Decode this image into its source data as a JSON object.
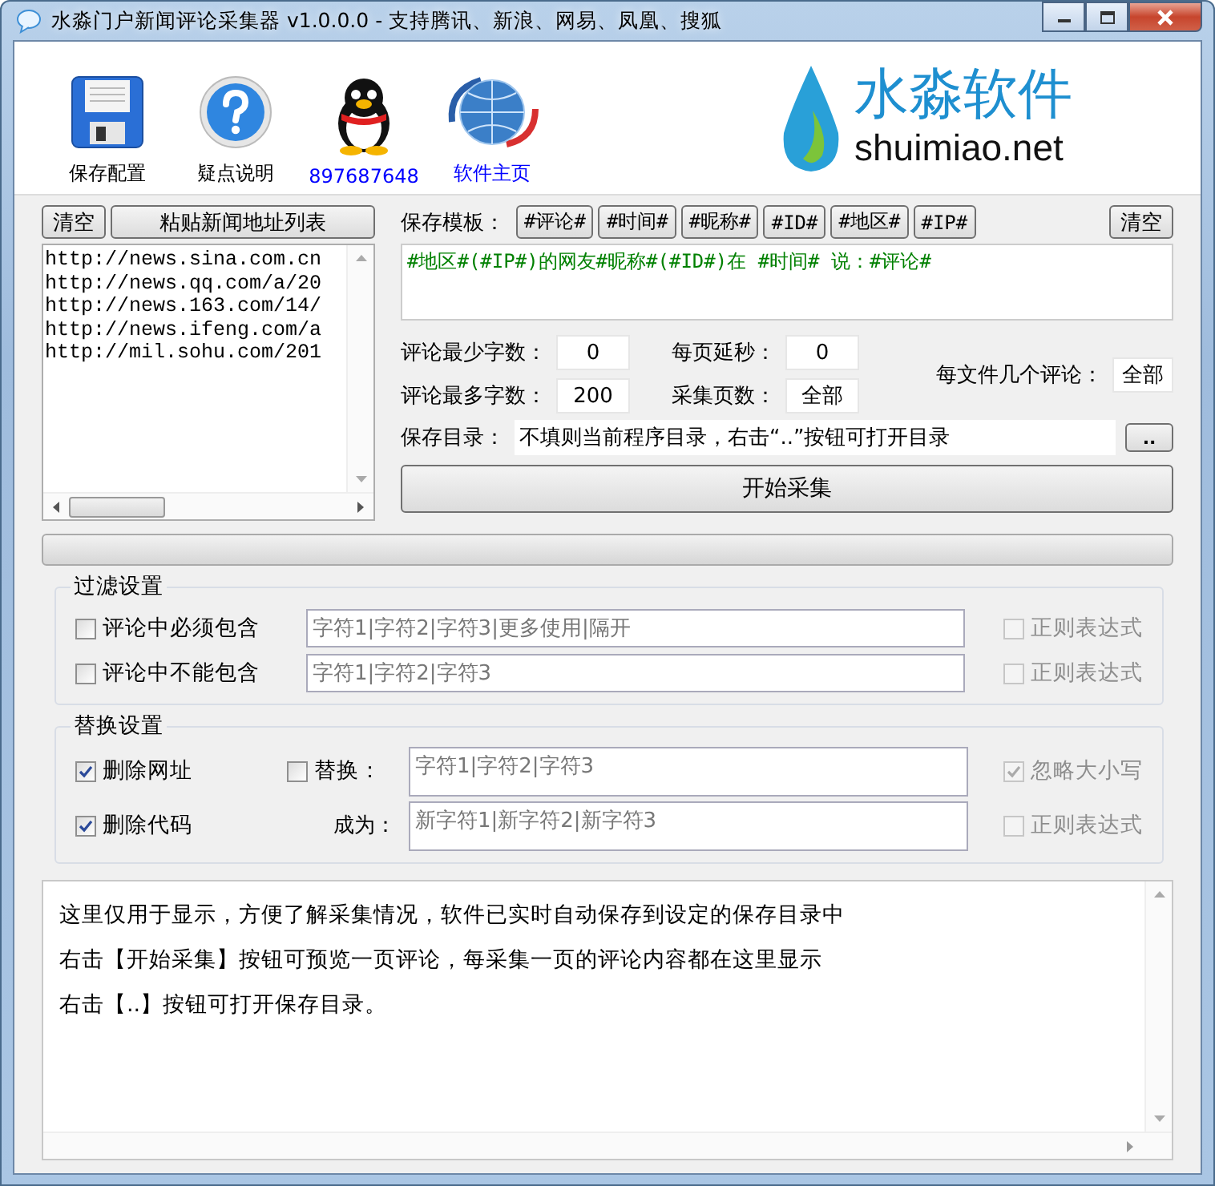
{
  "window": {
    "title": "水淼门户新闻评论采集器 v1.0.0.0 - 支持腾讯、新浪、网易、凤凰、搜狐"
  },
  "toolbar": [
    {
      "kind": "save",
      "label": "保存配置",
      "link": false
    },
    {
      "kind": "help",
      "label": "疑点说明",
      "link": false
    },
    {
      "kind": "qq",
      "label": "897687648",
      "link": true
    },
    {
      "kind": "globe",
      "label": "软件主页",
      "link": true
    }
  ],
  "logo": {
    "name": "水淼软件",
    "domain": "shuimiao.net"
  },
  "url_panel": {
    "clear_button": "清空",
    "paste_button": "粘贴新闻地址列表",
    "urls": [
      "http://news.sina.com.cn",
      "http://news.qq.com/a/20",
      "http://news.163.com/14/",
      "http://news.ifeng.com/a",
      "http://mil.sohu.com/201"
    ]
  },
  "template": {
    "label": "保存模板：",
    "tags": [
      "#评论#",
      "#时间#",
      "#昵称#",
      "#ID#",
      "#地区#",
      "#IP#"
    ],
    "clear_button": "清空",
    "value": "#地区#(#IP#)的网友#昵称#(#ID#)在 #时间# 说：#评论#"
  },
  "settings": {
    "min_chars": {
      "label": "评论最少字数：",
      "value": "0"
    },
    "max_chars": {
      "label": "评论最多字数：",
      "value": "200"
    },
    "delay": {
      "label": "每页延秒：",
      "value": "0"
    },
    "pages": {
      "label": "采集页数：",
      "value": "全部"
    },
    "per_file": {
      "label": "每文件几个评论：",
      "value": "全部"
    }
  },
  "save_dir": {
    "label": "保存目录：",
    "value": "不填则当前程序目录，右击“..”按钮可打开目录",
    "browse_button": ".."
  },
  "start_button": "开始采集",
  "progress": {
    "level": 0
  },
  "filter": {
    "title": "过滤设置",
    "rows": [
      {
        "check": {
          "label": "评论中必须包含",
          "checked": false
        },
        "placeholder": "字符1|字符2|字符3|更多使用|隔开",
        "regex": {
          "label": "正则表达式",
          "checked": false,
          "disabled": true
        }
      },
      {
        "check": {
          "label": "评论中不能包含",
          "checked": false
        },
        "placeholder": "字符1|字符2|字符3",
        "regex": {
          "label": "正则表达式",
          "checked": false,
          "disabled": true
        }
      }
    ]
  },
  "replace": {
    "title": "替换设置",
    "remove_url": {
      "label": "删除网址",
      "checked": true
    },
    "remove_code": {
      "label": "删除代码",
      "checked": true
    },
    "replace_check": {
      "label": "替换：",
      "checked": false
    },
    "find_placeholder": "字符1|字符2|字符3",
    "to_label": "成为：",
    "to_placeholder": "新字符1|新字符2|新字符3",
    "ignore_case": {
      "label": "忽略大小写",
      "checked": true,
      "disabled": true
    },
    "regex": {
      "label": "正则表达式",
      "checked": false,
      "disabled": true
    }
  },
  "log": {
    "lines": [
      "这里仅用于显示，方便了解采集情况，软件已实时自动保存到设定的保存目录中",
      "右击【开始采集】按钮可预览一页评论，每采集一页的评论内容都在这里显示",
      "右击【..】按钮可打开保存目录。"
    ]
  }
}
